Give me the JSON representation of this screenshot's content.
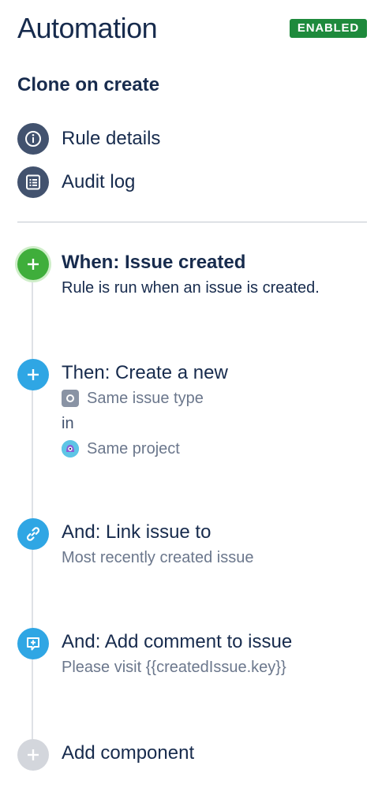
{
  "header": {
    "title": "Automation",
    "status_badge": "ENABLED"
  },
  "rule": {
    "name": "Clone on create"
  },
  "nav": {
    "items": [
      {
        "label": "Rule details",
        "icon": "info-icon"
      },
      {
        "label": "Audit log",
        "icon": "list-icon"
      }
    ]
  },
  "steps": [
    {
      "kind": "trigger",
      "title": "When: Issue created",
      "description": "Rule is run when an issue is created.",
      "icon": "plus-icon",
      "color": "#3fae3b"
    },
    {
      "kind": "action",
      "title": "Then: Create a new",
      "issue_type": "Same issue type",
      "connector": "in",
      "project": "Same project",
      "icon": "plus-icon",
      "color": "#2fa6e4"
    },
    {
      "kind": "action",
      "title": "And: Link issue to",
      "description": "Most recently created issue",
      "icon": "link-icon",
      "color": "#2fa6e4"
    },
    {
      "kind": "action",
      "title": "And: Add comment to issue",
      "description": "Please visit {{createdIssue.key}}",
      "icon": "comment-icon",
      "color": "#2fa6e4"
    }
  ],
  "add_component": {
    "label": "Add component",
    "icon": "plus-icon",
    "color": "#d3d6dc"
  }
}
